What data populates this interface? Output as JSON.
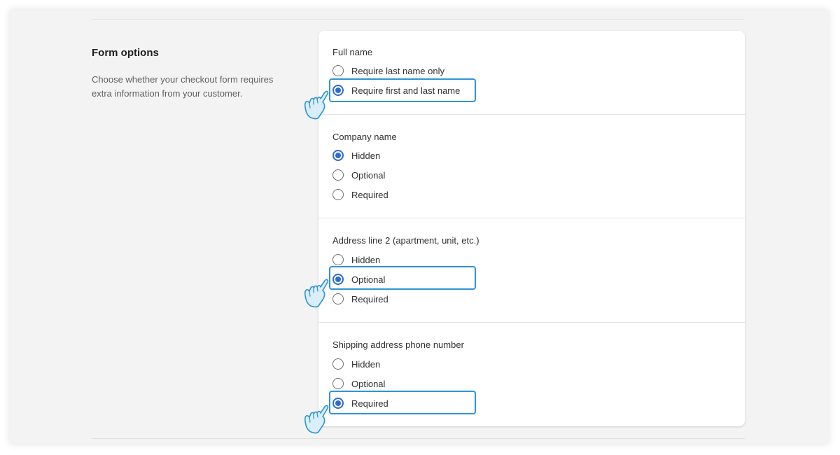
{
  "section": {
    "title": "Form options",
    "description": "Choose whether your checkout form requires extra information from your customer."
  },
  "groups": [
    {
      "label": "Full name",
      "options": [
        {
          "label": "Require last name only",
          "checked": false
        },
        {
          "label": "Require first and last name",
          "checked": true
        }
      ]
    },
    {
      "label": "Company name",
      "options": [
        {
          "label": "Hidden",
          "checked": true
        },
        {
          "label": "Optional",
          "checked": false
        },
        {
          "label": "Required",
          "checked": false
        }
      ]
    },
    {
      "label": "Address line 2 (apartment, unit, etc.)",
      "options": [
        {
          "label": "Hidden",
          "checked": false
        },
        {
          "label": "Optional",
          "checked": true
        },
        {
          "label": "Required",
          "checked": false
        }
      ]
    },
    {
      "label": "Shipping address phone number",
      "options": [
        {
          "label": "Hidden",
          "checked": false
        },
        {
          "label": "Optional",
          "checked": false
        },
        {
          "label": "Required",
          "checked": true
        }
      ]
    }
  ],
  "colors": {
    "accent": "#2f6bd1",
    "highlight": "#2f94d6"
  },
  "annotations": {
    "icon": "pointing-hand-icon"
  }
}
